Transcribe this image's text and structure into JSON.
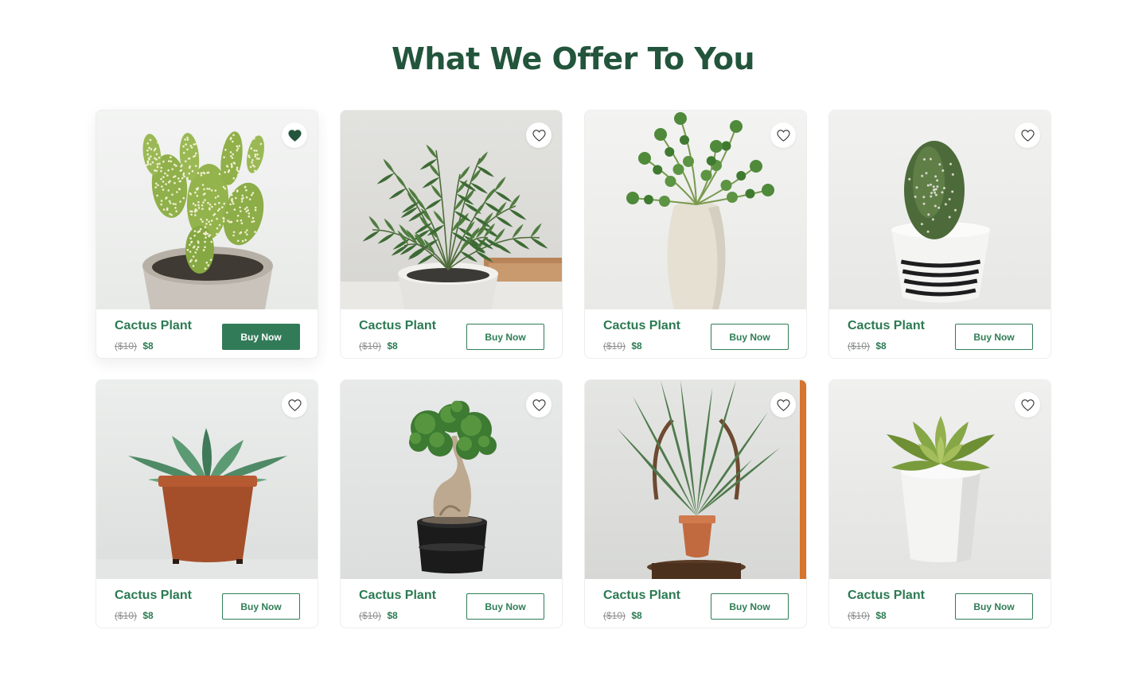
{
  "section": {
    "title": "What We Offer To You"
  },
  "theme": {
    "accent": "#2b7a52",
    "title_color": "#23553c",
    "favorite_fill": "#23553c"
  },
  "products": [
    {
      "name": "Cactus Plant",
      "old_price": "($10)",
      "price": "$8",
      "cta": "Buy Now",
      "favorited": true,
      "cta_style": "filled",
      "image": "bunny-ear-cactus-in-stone-pot"
    },
    {
      "name": "Cactus Plant",
      "old_price": "($10)",
      "price": "$8",
      "cta": "Buy Now",
      "favorited": false,
      "cta_style": "outline",
      "image": "parlor-palm-in-white-pot"
    },
    {
      "name": "Cactus Plant",
      "old_price": "($10)",
      "price": "$8",
      "cta": "Buy Now",
      "favorited": false,
      "cta_style": "outline",
      "image": "pea-shoots-in-white-vase"
    },
    {
      "name": "Cactus Plant",
      "old_price": "($10)",
      "price": "$8",
      "cta": "Buy Now",
      "favorited": false,
      "cta_style": "outline",
      "image": "round-cactus-in-striped-pot"
    },
    {
      "name": "Cactus Plant",
      "old_price": "($10)",
      "price": "$8",
      "cta": "Buy Now",
      "favorited": false,
      "cta_style": "outline",
      "image": "snake-plant-in-terracotta-pot"
    },
    {
      "name": "Cactus Plant",
      "old_price": "($10)",
      "price": "$8",
      "cta": "Buy Now",
      "favorited": false,
      "cta_style": "outline",
      "image": "bonsai-in-black-pot"
    },
    {
      "name": "Cactus Plant",
      "old_price": "($10)",
      "price": "$8",
      "cta": "Buy Now",
      "favorited": false,
      "cta_style": "outline",
      "image": "palm-on-wooden-chair"
    },
    {
      "name": "Cactus Plant",
      "old_price": "($10)",
      "price": "$8",
      "cta": "Buy Now",
      "favorited": false,
      "cta_style": "outline",
      "image": "succulent-in-white-pot"
    }
  ]
}
